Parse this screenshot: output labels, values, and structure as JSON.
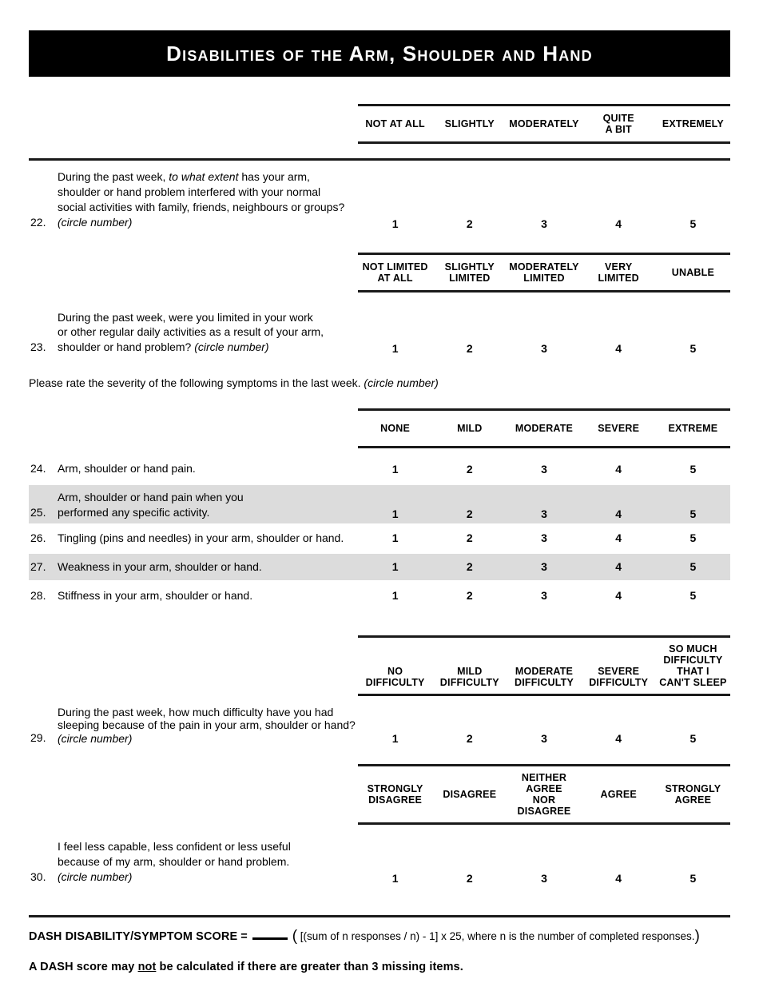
{
  "header": {
    "title": "Disabilities of the Arm, Shoulder and Hand"
  },
  "scales": {
    "extent": {
      "columns": [
        {
          "lines": [
            "NOT AT ALL"
          ]
        },
        {
          "lines": [
            "SLIGHTLY"
          ]
        },
        {
          "lines": [
            "MODERATELY"
          ]
        },
        {
          "lines": [
            "QUITE",
            "A BIT"
          ]
        },
        {
          "lines": [
            "EXTREMELY"
          ]
        }
      ]
    },
    "limited": {
      "columns": [
        {
          "lines": [
            "NOT LIMITED",
            "AT ALL"
          ]
        },
        {
          "lines": [
            "SLIGHTLY",
            "LIMITED"
          ]
        },
        {
          "lines": [
            "MODERATELY",
            "LIMITED"
          ]
        },
        {
          "lines": [
            "VERY",
            "LIMITED"
          ]
        },
        {
          "lines": [
            "UNABLE"
          ]
        }
      ]
    },
    "severity": {
      "columns": [
        {
          "lines": [
            "NONE"
          ]
        },
        {
          "lines": [
            "MILD"
          ]
        },
        {
          "lines": [
            "MODERATE"
          ]
        },
        {
          "lines": [
            "SEVERE"
          ]
        },
        {
          "lines": [
            "EXTREME"
          ]
        }
      ]
    },
    "difficulty": {
      "columns": [
        {
          "lines": [
            "NO",
            "DIFFICULTY"
          ]
        },
        {
          "lines": [
            "MILD",
            "DIFFICULTY"
          ]
        },
        {
          "lines": [
            "MODERATE",
            "DIFFICULTY"
          ]
        },
        {
          "lines": [
            "SEVERE",
            "DIFFICULTY"
          ]
        },
        {
          "lines": [
            "SO MUCH",
            "DIFFICULTY",
            "THAT I",
            "CAN'T SLEEP"
          ]
        }
      ]
    },
    "agreement": {
      "columns": [
        {
          "lines": [
            "STRONGLY",
            "DISAGREE"
          ]
        },
        {
          "lines": [
            "DISAGREE"
          ]
        },
        {
          "lines": [
            "NEITHER AGREE",
            "NOR DISAGREE"
          ]
        },
        {
          "lines": [
            "AGREE"
          ]
        },
        {
          "lines": [
            "STRONGLY",
            "AGREE"
          ]
        }
      ]
    }
  },
  "response_values": [
    "1",
    "2",
    "3",
    "4",
    "5"
  ],
  "questions": {
    "q22": {
      "number": "22.",
      "line1_a": "During the past week, ",
      "line1_i": "to what extent",
      "line1_b": " has your arm,",
      "line2": "shoulder or hand problem interfered with your normal",
      "line3": "social activities with family, friends, neighbours or groups?",
      "line4_i": "(circle number)"
    },
    "q23": {
      "number": "23.",
      "line1": "During the past week, were you limited in your work",
      "line2": "or other regular daily activities as a result of your arm,",
      "line3_a": "shoulder or hand problem? ",
      "line3_i": "(circle number)"
    },
    "instruction": {
      "text_a": "Please rate the severity of the following symptoms in the last week. ",
      "text_i": "(circle number)"
    },
    "q24": {
      "number": "24.",
      "line1": "Arm, shoulder or hand pain."
    },
    "q25": {
      "number": "25.",
      "line1": "Arm, shoulder or hand pain when you",
      "line2": "performed any specific activity."
    },
    "q26": {
      "number": "26.",
      "line1": "Tingling (pins and needles) in your arm, shoulder or hand."
    },
    "q27": {
      "number": "27.",
      "line1": "Weakness in your arm, shoulder or hand."
    },
    "q28": {
      "number": "28.",
      "line1": "Stiffness in your arm, shoulder or hand."
    },
    "q29": {
      "number": "29.",
      "line1": "During the past week, how much difficulty have you had",
      "line2": "sleeping because of the pain in your arm, shoulder or hand?",
      "line3_i": "(circle number)"
    },
    "q30": {
      "number": "30.",
      "line1": "I feel less capable, less confident or less useful",
      "line2": "because of my arm, shoulder or hand problem.",
      "line3_i": "(circle number)"
    }
  },
  "footer": {
    "score_label": "DASH DISABILITY/SYMPTOM SCORE",
    "equals": "=",
    "score_value": "",
    "formula_open": "(",
    "formula": " [(sum of n responses /  n) - 1] x 25, where n is the number of completed responses.",
    "formula_close": ")",
    "note_a": "A DASH score may ",
    "note_u": "not",
    "note_b": " be calculated if there are greater than 3 missing items."
  },
  "colors": {
    "banner_background": "#000000",
    "banner_text": "#ffffff",
    "row_shade": "#dcdcdc",
    "rule": "#1a1a1a"
  }
}
